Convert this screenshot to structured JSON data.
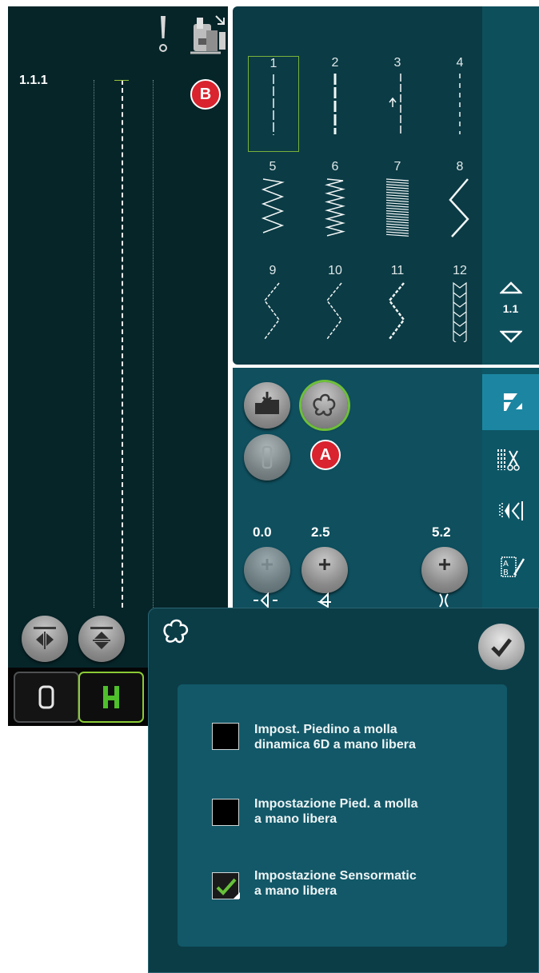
{
  "preview": {
    "stitch_id": "1.1.1"
  },
  "stitch_grid": {
    "cells": [
      {
        "num": "1",
        "kind": "straight-thin"
      },
      {
        "num": "2",
        "kind": "straight-bold"
      },
      {
        "num": "3",
        "kind": "straight-reverse"
      },
      {
        "num": "4",
        "kind": "straight-dash"
      },
      {
        "num": "5",
        "kind": "zigzag-wide"
      },
      {
        "num": "6",
        "kind": "zigzag-dense"
      },
      {
        "num": "7",
        "kind": "satin"
      },
      {
        "num": "8",
        "kind": "zigzag-large"
      },
      {
        "num": "9",
        "kind": "zigzag-3step"
      },
      {
        "num": "10",
        "kind": "zigzag-3step"
      },
      {
        "num": "11",
        "kind": "zigzag-3step-bold"
      },
      {
        "num": "12",
        "kind": "honeycomb"
      }
    ],
    "selected": "1",
    "page": "1.1"
  },
  "controls": {
    "width_value": "0.0",
    "length_value": "2.5",
    "density_value": "5.2"
  },
  "callouts": {
    "a": "A",
    "b": "B"
  },
  "popup": {
    "icon": "free-motion-icon",
    "options": [
      {
        "label": "Impost. Piedino a molla\ndinamica 6D a mano libera",
        "checked": false
      },
      {
        "label": "Impostazione Pied. a molla\na mano libera",
        "checked": false
      },
      {
        "label": "Impostazione Sensormatic\na mano libera",
        "checked": true
      }
    ]
  },
  "colors": {
    "accent_green": "#8acb35",
    "callout_red": "#d9232e",
    "panel_teal": "#0b3d47"
  }
}
